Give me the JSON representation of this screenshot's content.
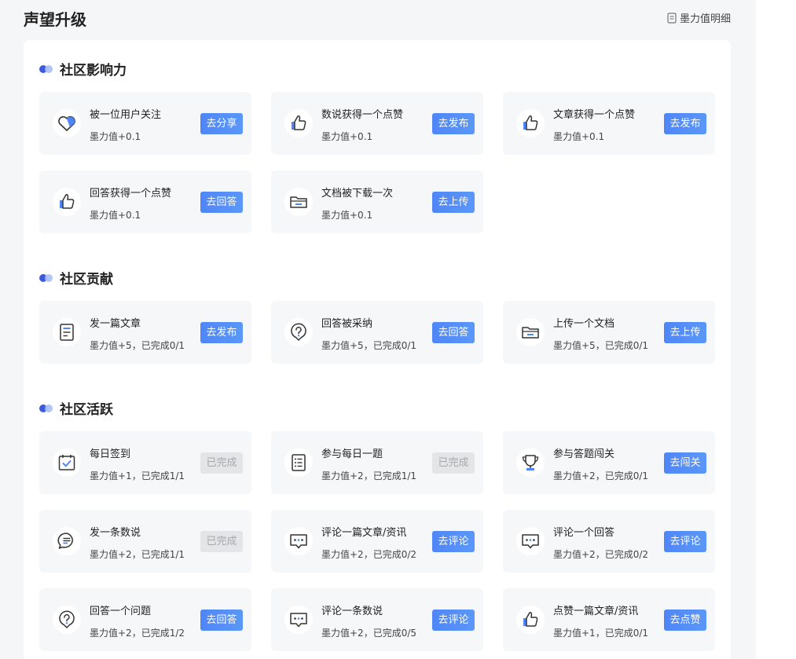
{
  "header": {
    "title": "声望升级",
    "detail_link": "墨力值明细"
  },
  "sections": [
    {
      "title": "社区影响力",
      "tasks": [
        {
          "icon": "heart-icon",
          "title": "被一位用户关注",
          "desc": "墨力值+0.1",
          "button": "去分享",
          "done": false
        },
        {
          "icon": "thumbs-up-icon",
          "title": "数说获得一个点赞",
          "desc": "墨力值+0.1",
          "button": "去发布",
          "done": false
        },
        {
          "icon": "thumbs-up-icon",
          "title": "文章获得一个点赞",
          "desc": "墨力值+0.1",
          "button": "去发布",
          "done": false
        },
        {
          "icon": "thumbs-up-icon",
          "title": "回答获得一个点赞",
          "desc": "墨力值+0.1",
          "button": "去回答",
          "done": false
        },
        {
          "icon": "folder-icon",
          "title": "文档被下载一次",
          "desc": "墨力值+0.1",
          "button": "去上传",
          "done": false
        }
      ]
    },
    {
      "title": "社区贡献",
      "tasks": [
        {
          "icon": "document-icon",
          "title": "发一篇文章",
          "desc": "墨力值+5，已完成0/1",
          "button": "去发布",
          "done": false
        },
        {
          "icon": "question-icon",
          "title": "回答被采纳",
          "desc": "墨力值+5，已完成0/1",
          "button": "去回答",
          "done": false
        },
        {
          "icon": "folder-icon",
          "title": "上传一个文档",
          "desc": "墨力值+5，已完成0/1",
          "button": "去上传",
          "done": false
        }
      ]
    },
    {
      "title": "社区活跃",
      "tasks": [
        {
          "icon": "calendar-check-icon",
          "title": "每日签到",
          "desc": "墨力值+1，已完成1/1",
          "button": "已完成",
          "done": true
        },
        {
          "icon": "list-icon",
          "title": "参与每日一题",
          "desc": "墨力值+2，已完成1/1",
          "button": "已完成",
          "done": true
        },
        {
          "icon": "trophy-icon",
          "title": "参与答题闯关",
          "desc": "墨力值+2，已完成0/1",
          "button": "去闯关",
          "done": false
        },
        {
          "icon": "chat-icon",
          "title": "发一条数说",
          "desc": "墨力值+2，已完成1/1",
          "button": "已完成",
          "done": true
        },
        {
          "icon": "comment-icon",
          "title": "评论一篇文章/资讯",
          "desc": "墨力值+2，已完成0/2",
          "button": "去评论",
          "done": false
        },
        {
          "icon": "comment-icon",
          "title": "评论一个回答",
          "desc": "墨力值+2，已完成0/2",
          "button": "去评论",
          "done": false
        },
        {
          "icon": "question-icon",
          "title": "回答一个问题",
          "desc": "墨力值+2，已完成1/2",
          "button": "去回答",
          "done": false
        },
        {
          "icon": "comment-icon",
          "title": "评论一条数说",
          "desc": "墨力值+2，已完成0/5",
          "button": "去评论",
          "done": false
        },
        {
          "icon": "thumbs-up-icon",
          "title": "点赞一篇文章/资讯",
          "desc": "墨力值+1，已完成0/1",
          "button": "去点赞",
          "done": false
        }
      ]
    }
  ],
  "colors": {
    "accent": "#4f86f7",
    "dot_primary": "#3b5bdb",
    "dot_secondary": "#a9bff5",
    "done_bg": "#e4e5e7"
  }
}
